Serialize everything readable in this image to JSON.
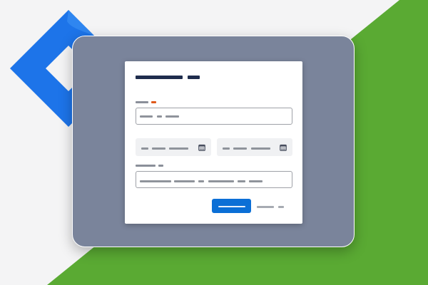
{
  "colors": {
    "page_background": "#f4f4f5",
    "brand_green": "#5aaa33",
    "brand_green_dark": "#4b9a2b",
    "jira_blue": "#1d74e9",
    "jira_blue_light": "#2f86f0",
    "panel": "#7a849b",
    "dialog": "#ffffff",
    "title_placeholder": "#1f2d4d",
    "label_placeholder": "#8a8f99",
    "required_marker": "#e05a1c",
    "text_placeholder": "#8f939b",
    "field_border": "#9ea1a7",
    "field_fill": "#f0f1f3",
    "primary_button": "#0b6fd6",
    "primary_button_text": "#e8f1fc",
    "secondary_text": "#a7abb2",
    "calendar_icon": "#4a5060"
  },
  "logo": {
    "icon": "jira-logo"
  },
  "dialog": {
    "title_segments": 2,
    "fields": [
      {
        "id": "required-text-field",
        "label_segments": 1,
        "required": true,
        "value_segments": 3,
        "style": "outlined"
      },
      {
        "id": "start-date-field",
        "value_segments": 3,
        "style": "filled",
        "icon": "calendar-icon"
      },
      {
        "id": "due-date-field",
        "value_segments": 3,
        "style": "filled",
        "icon": "calendar-icon"
      },
      {
        "id": "long-text-field",
        "label_segments": 2,
        "value_segments": 6,
        "style": "outlined"
      }
    ],
    "buttons": [
      {
        "id": "submit-button",
        "style": "primary",
        "text_segments": 1
      },
      {
        "id": "cancel-link",
        "style": "subtle",
        "text_segments": 2
      }
    ]
  }
}
